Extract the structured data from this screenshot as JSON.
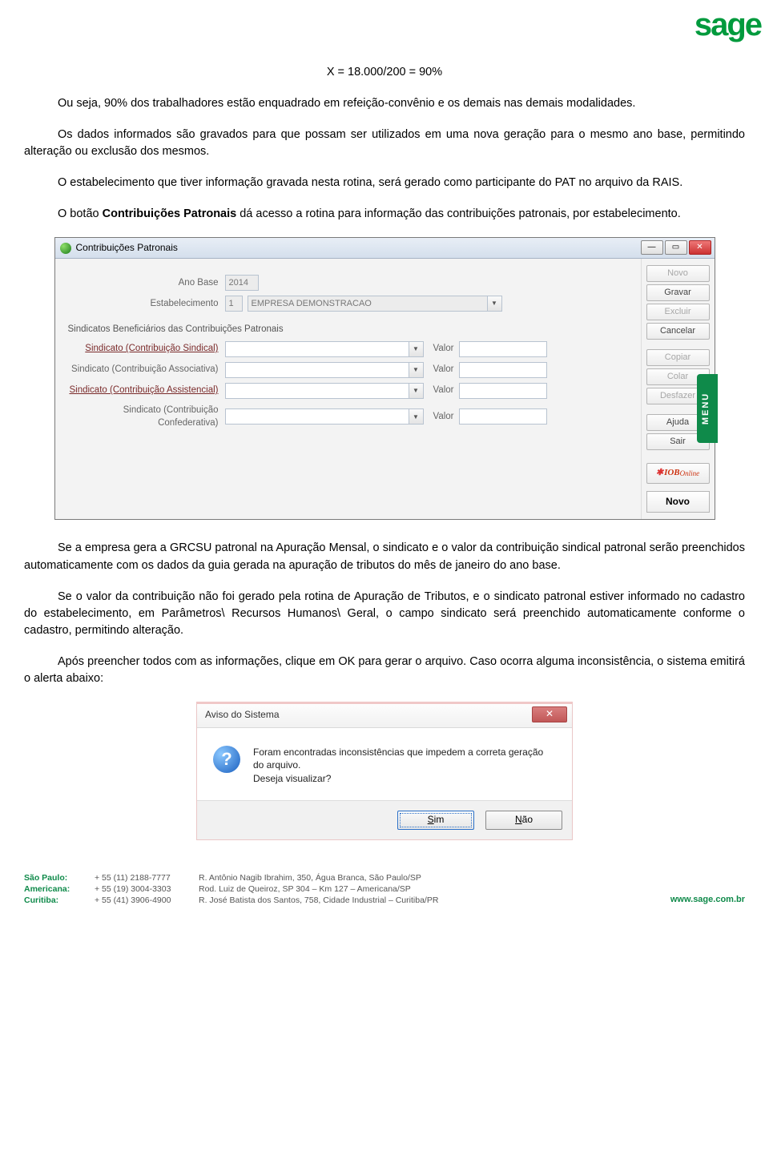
{
  "logo_text": "sage",
  "equation": "X = 18.000/200 = 90%",
  "p1": "Ou seja, 90% dos trabalhadores estão enquadrado em refeição-convênio e os demais nas demais modalidades.",
  "p2": "Os dados informados são gravados para que possam ser utilizados em uma nova geração para o mesmo ano base, permitindo alteração ou exclusão dos mesmos.",
  "p3": "O estabelecimento que tiver informação gravada nesta rotina, será gerado como participante do PAT no arquivo da RAIS.",
  "p4a": "O botão ",
  "p4b": "Contribuições Patronais",
  "p4c": " dá acesso a rotina para informação das contribuições patronais, por estabelecimento.",
  "win1": {
    "title": "Contribuições Patronais",
    "ano_label": "Ano Base",
    "ano_value": "2014",
    "est_label": "Estabelecimento",
    "est_code": "1",
    "est_name": "EMPRESA DEMONSTRACAO",
    "group": "Sindicatos Beneficiários das Contribuições Patronais",
    "rows": [
      {
        "label": "Sindicato (Contribuição Sindical)",
        "link": true
      },
      {
        "label": "Sindicato (Contribuição Associativa)",
        "link": false
      },
      {
        "label": "Sindicato (Contribuição Assistencial)",
        "link": true
      },
      {
        "label": "Sindicato (Contribuição Confederativa)",
        "link": false
      }
    ],
    "valor_label": "Valor",
    "buttons": {
      "novo": "Novo",
      "gravar": "Gravar",
      "excluir": "Excluir",
      "cancelar": "Cancelar",
      "copiar": "Copiar",
      "colar": "Colar",
      "desfazer": "Desfazer",
      "ajuda": "Ajuda",
      "sair": "Sair",
      "iob": "IOBOnline"
    },
    "status": "Novo",
    "menu_tab": "MENU"
  },
  "p5": "Se a empresa gera a GRCSU patronal na Apuração Mensal, o sindicato e o valor da contribuição sindical patronal serão preenchidos automaticamente com os dados da guia gerada na apuração de tributos do mês de janeiro do ano base.",
  "p6": "Se o valor da contribuição não foi gerado pela rotina de Apuração de Tributos, e o sindicato patronal estiver informado no cadastro do estabelecimento, em Parâmetros\\ Recursos Humanos\\ Geral, o campo sindicato será preenchido automaticamente conforme o cadastro, permitindo alteração.",
  "p7": "Após preencher todos com as informações, clique em OK para gerar o arquivo. Caso ocorra alguma inconsistência, o sistema emitirá o alerta abaixo:",
  "win2": {
    "title": "Aviso do Sistema",
    "msg1": "Foram encontradas inconsistências que impedem a correta geração do arquivo.",
    "msg2": "Deseja visualizar?",
    "yes": "Sim",
    "no": "Não"
  },
  "footer": {
    "cities": [
      "São Paulo:",
      "Americana:",
      "Curitiba:"
    ],
    "phones": [
      "+ 55 (11) 2188-7777",
      "+ 55 (19) 3004-3303",
      "+ 55 (41) 3906-4900"
    ],
    "addrs": [
      "R. Antônio Nagib Ibrahim, 350, Água Branca, São Paulo/SP",
      "Rod. Luiz de Queiroz, SP 304 – Km 127 – Americana/SP",
      "R. José Batista dos Santos, 758, Cidade Industrial – Curitiba/PR"
    ],
    "site": "www.sage.com.br"
  }
}
